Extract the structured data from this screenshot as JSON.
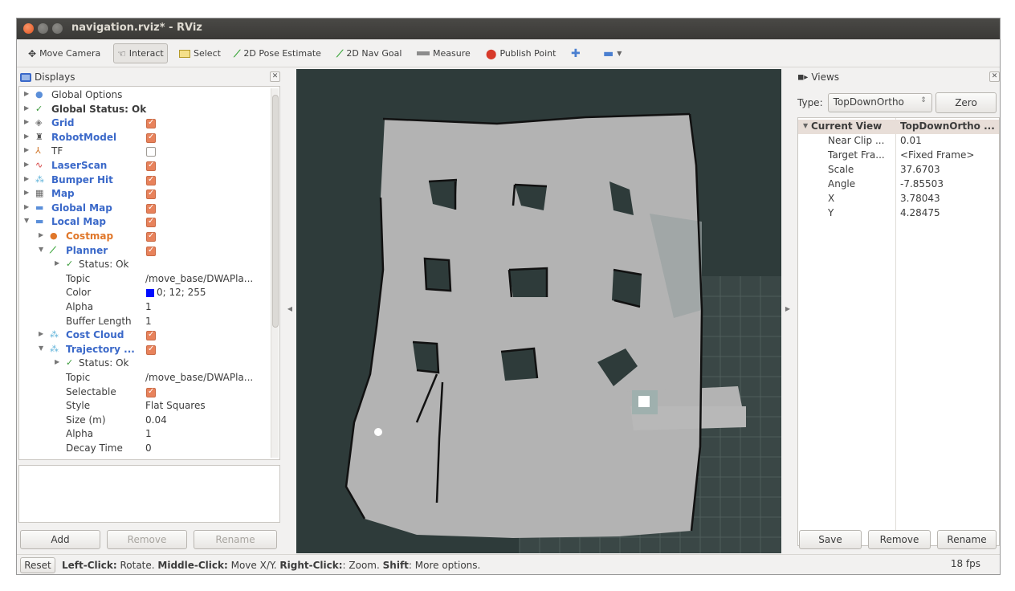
{
  "window": {
    "title": "navigation.rviz* - RViz"
  },
  "toolbar": {
    "move_camera": "Move Camera",
    "interact": "Interact",
    "select": "Select",
    "pose_estimate": "2D Pose Estimate",
    "nav_goal": "2D Nav Goal",
    "measure": "Measure",
    "publish_point": "Publish Point"
  },
  "displays": {
    "title": "Displays",
    "items": [
      {
        "label": "Global Options"
      },
      {
        "label": "Global Status: Ok"
      },
      {
        "label": "Grid"
      },
      {
        "label": "RobotModel"
      },
      {
        "label": "TF"
      },
      {
        "label": "LaserScan"
      },
      {
        "label": "Bumper Hit"
      },
      {
        "label": "Map"
      },
      {
        "label": "Global Map"
      },
      {
        "label": "Local Map"
      },
      {
        "label": "Costmap"
      },
      {
        "label": "Planner"
      },
      {
        "label": "Status: Ok"
      },
      {
        "label": "Topic",
        "value": "/move_base/DWAPla..."
      },
      {
        "label": "Color",
        "value": "0; 12; 255"
      },
      {
        "label": "Alpha",
        "value": "1"
      },
      {
        "label": "Buffer Length",
        "value": "1"
      },
      {
        "label": "Cost Cloud"
      },
      {
        "label": "Trajectory ..."
      },
      {
        "label": "Status: Ok"
      },
      {
        "label": "Topic",
        "value": "/move_base/DWAPla..."
      },
      {
        "label": "Selectable"
      },
      {
        "label": "Style",
        "value": "Flat Squares"
      },
      {
        "label": "Size (m)",
        "value": "0.04"
      },
      {
        "label": "Alpha",
        "value": "1"
      },
      {
        "label": "Decay Time",
        "value": "0"
      }
    ],
    "add_label": "Add",
    "remove_label": "Remove",
    "rename_label": "Rename"
  },
  "views": {
    "title": "Views",
    "type_label": "Type:",
    "type_value": "TopDownOrtho",
    "zero_label": "Zero",
    "current_view": {
      "label": "Current View",
      "value": "TopDownOrtho ..."
    },
    "props": [
      {
        "key": "Near Clip ...",
        "value": "0.01"
      },
      {
        "key": "Target Fra...",
        "value": "<Fixed Frame>"
      },
      {
        "key": "Scale",
        "value": "37.6703"
      },
      {
        "key": "Angle",
        "value": "-7.85503"
      },
      {
        "key": "X",
        "value": "3.78043"
      },
      {
        "key": "Y",
        "value": "4.28475"
      }
    ],
    "save_label": "Save",
    "remove_label": "Remove",
    "rename_label": "Rename"
  },
  "status": {
    "reset_label": "Reset",
    "hint_left_key": "Left-Click:",
    "hint_left": " Rotate. ",
    "hint_mid_key": "Middle-Click:",
    "hint_mid": " Move X/Y. ",
    "hint_right_key": "Right-Click:",
    "hint_right": ": Zoom. ",
    "hint_shift_key": "Shift",
    "hint_shift": ": More options.",
    "fps": "18 fps"
  },
  "colors": {
    "viewport_bg": "#2e3b3a",
    "map_free": "#b3b3b3",
    "accent_blue": "#3b69c9",
    "checkbox_on": "#e8825b"
  }
}
